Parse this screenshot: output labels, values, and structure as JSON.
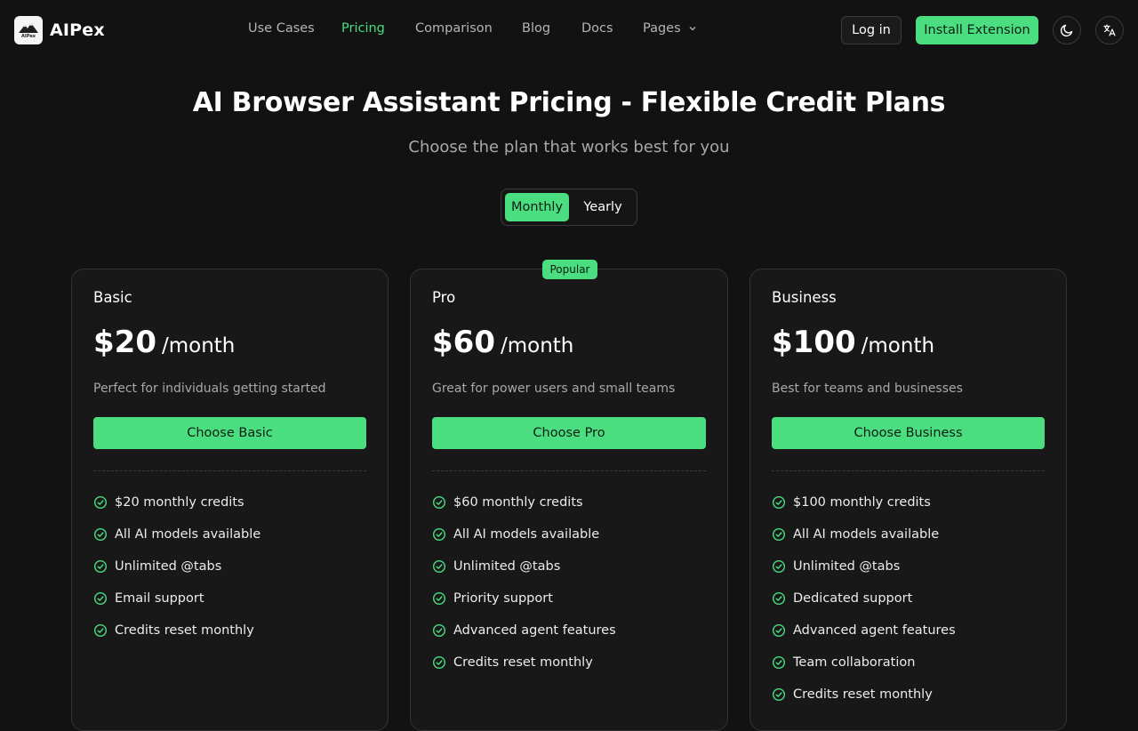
{
  "brand": {
    "name": "AIPex",
    "logo_text": "AIPex"
  },
  "nav": {
    "items": [
      {
        "label": "Use Cases"
      },
      {
        "label": "Pricing"
      },
      {
        "label": "Comparison"
      },
      {
        "label": "Blog"
      },
      {
        "label": "Docs"
      },
      {
        "label": "Pages"
      }
    ],
    "active": "Pricing"
  },
  "header_actions": {
    "login_label": "Log in",
    "install_label": "Install Extension",
    "theme_icon": "moon-icon",
    "language_icon": "translate-icon"
  },
  "hero": {
    "title": "AI Browser Assistant Pricing - Flexible Credit Plans",
    "subtitle": "Choose the plan that works best for you"
  },
  "billing_toggle": {
    "options": [
      "Monthly",
      "Yearly"
    ],
    "selected": "Monthly"
  },
  "plans": [
    {
      "name": "Basic",
      "price": "$20",
      "period": "/month",
      "description": "Perfect for individuals getting started",
      "cta": "Choose Basic",
      "features": [
        "$20 monthly credits",
        "All AI models available",
        "Unlimited @tabs",
        "Email support",
        "Credits reset monthly"
      ]
    },
    {
      "name": "Pro",
      "badge": "Popular",
      "price": "$60",
      "period": "/month",
      "description": "Great for power users and small teams",
      "cta": "Choose Pro",
      "features": [
        "$60 monthly credits",
        "All AI models available",
        "Unlimited @tabs",
        "Priority support",
        "Advanced agent features",
        "Credits reset monthly"
      ]
    },
    {
      "name": "Business",
      "price": "$100",
      "period": "/month",
      "description": "Best for teams and businesses",
      "cta": "Choose Business",
      "features": [
        "$100 monthly credits",
        "All AI models available",
        "Unlimited @tabs",
        "Dedicated support",
        "Advanced agent features",
        "Team collaboration",
        "Credits reset monthly"
      ]
    }
  ],
  "colors": {
    "accent": "#4ade80",
    "background": "#121212",
    "card": "#181818",
    "muted_text": "#a8a8a8"
  }
}
